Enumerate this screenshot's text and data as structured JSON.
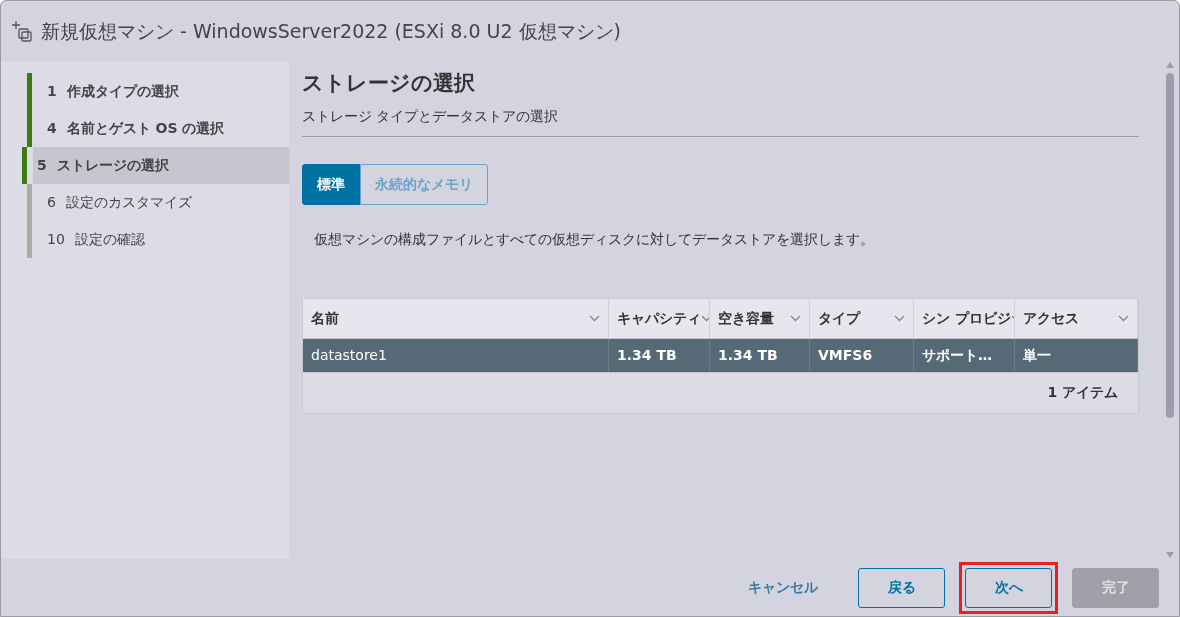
{
  "window": {
    "title": "新規仮想マシン - WindowsServer2022 (ESXi 8.0 U2 仮想マシン)"
  },
  "steps": [
    {
      "number": "1",
      "label": "作成タイプの選択",
      "completed": true,
      "selected": false
    },
    {
      "number": "4",
      "label": "名前とゲスト OS の選択",
      "completed": true,
      "selected": false
    },
    {
      "number": "5",
      "label": "ストレージの選択",
      "completed": true,
      "selected": true
    },
    {
      "number": "6",
      "label": "設定のカスタマイズ",
      "completed": false,
      "selected": false
    },
    {
      "number": "10",
      "label": "設定の確認",
      "completed": false,
      "selected": false
    }
  ],
  "page": {
    "title": "ストレージの選択",
    "subtitle": "ストレージ タイプとデータストアの選択",
    "description": "仮想マシンの構成ファイルとすべての仮想ディスクに対してデータストアを選択します。"
  },
  "storage_tabs": [
    {
      "label": "標準",
      "selected": true
    },
    {
      "label": "永続的なメモリ",
      "selected": false
    }
  ],
  "table": {
    "columns": [
      "名前",
      "キャパシティ",
      "空き容量",
      "タイプ",
      "シン プロビジ",
      "アクセス"
    ],
    "rows": [
      {
        "cells": [
          "datastore1",
          "1.34 TB",
          "1.34 TB",
          "VMFS6",
          "サポート…",
          "単一"
        ],
        "selected": true
      }
    ],
    "footer": "1 アイテム"
  },
  "buttons": [
    {
      "label": "キャンセル",
      "kind": "link",
      "disabled": false,
      "highlighted": false
    },
    {
      "label": "戻る",
      "kind": "outline",
      "disabled": false,
      "highlighted": false
    },
    {
      "label": "次へ",
      "kind": "outline",
      "disabled": false,
      "highlighted": true
    },
    {
      "label": "完了",
      "kind": "solid",
      "disabled": true,
      "highlighted": false
    }
  ]
}
